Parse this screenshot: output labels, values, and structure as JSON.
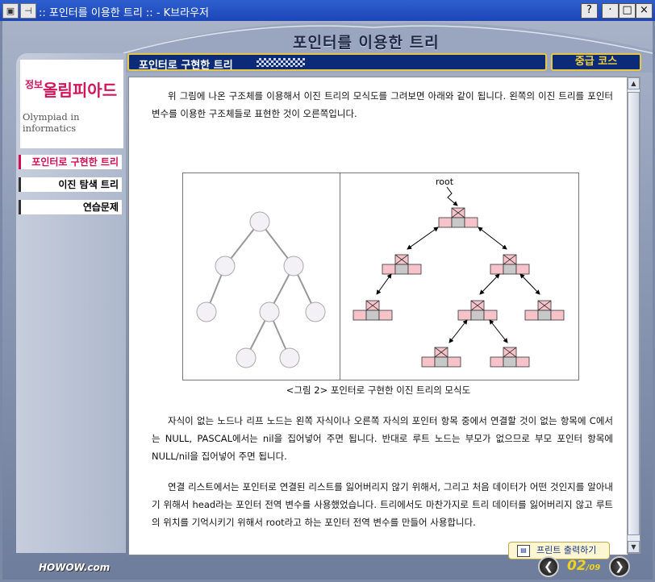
{
  "window": {
    "title": ":: 포인터를 이용한 트리 :: - K브라우저",
    "help_label": "?",
    "minimize_label": "·",
    "maximize_label": "□",
    "close_label": "×",
    "menu_icon_label": "▣",
    "pin_icon_label": "⊣"
  },
  "header": {
    "title": "포인터를 이용한 트리"
  },
  "topbar": {
    "section_title": "포인터로 구현한 트리",
    "level": "중급 코스"
  },
  "sidebar": {
    "logo_small": "정보",
    "logo_main": "올림피아드",
    "logo_en": "Olympiad in informatics",
    "items": [
      {
        "label": "포인터로 구현한 트리"
      },
      {
        "label": "이진 탐색 트리"
      },
      {
        "label": "연습문제"
      }
    ]
  },
  "content": {
    "para1": "위 그림에 나온 구조체를 이용해서 이진 트리의 모식도를 그려보면 아래와 같이 됩니다. 왼쪽의 이진 트리를 포인터 변수를 이용한 구조체들로 표현한 것이 오른쪽입니다.",
    "root_label": "root",
    "caption": "<그림 2> 포인터로 구현한 이진 트리의 모식도",
    "para2": "자식이 없는 노드나 리프 노드는 왼쪽 자식이나 오른쪽 자식의 포인터 항목 중에서 연결할 것이 없는 항목에 C에서는 NULL, PASCAL에서는 nil을 집어넣어 주면 됩니다. 반대로 루트 노드는 부모가 없으므로 부모 포인터 항목에 NULL/nil을 집어넣어 주면 됩니다.",
    "para3": "연결 리스트에서는 포인터로 연결된 리스트를 잃어버리지 않기 위해서, 그리고 처음 데이터가 어떤 것인지를 알아내기 위해서 head라는 포인터 전역 변수를 사용했었습니다. 트리에서도 마찬가지로 트리 데이터를 잃어버리지 않고 루트의 위치를 기억시키기 위해서 root라고 하는 포인터 전역 변수를 만들어 사용합니다.",
    "print_label": "프린트 출력하기"
  },
  "footer": {
    "brand": "HOWOW.com",
    "page_current": "02",
    "page_total": "09",
    "prev_label": "❮",
    "next_label": "❯"
  },
  "colors": {
    "accent_pink": "#d01050",
    "bar_navy": "#0b2a78",
    "bar_border": "#e7c642",
    "page_yellow": "#f0d320"
  }
}
